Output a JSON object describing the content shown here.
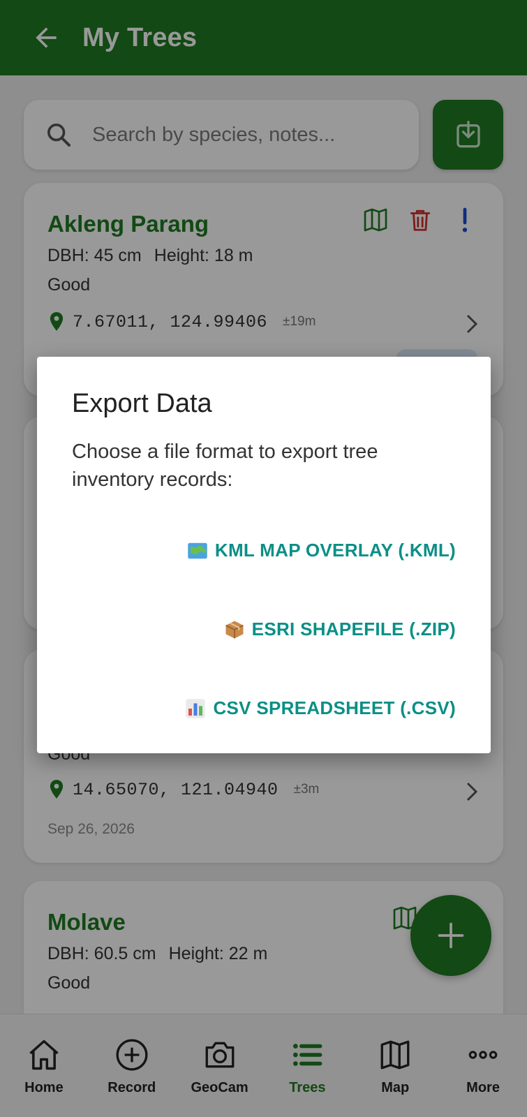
{
  "appbar": {
    "title": "My Trees"
  },
  "search": {
    "placeholder": "Search by species, notes..."
  },
  "cards": [
    {
      "species": "Akleng Parang",
      "dbh": "DBH: 45 cm",
      "height": "Height: 18 m",
      "condition": "Good",
      "coords": "7.67011, 124.99406",
      "accuracy": "±19m"
    },
    {
      "condition": "Good",
      "coords": "14.65070, 121.04940",
      "accuracy": "±3m",
      "date": "Sep 26, 2026"
    },
    {
      "species": "Molave",
      "dbh": "DBH: 60.5 cm",
      "height": "Height: 22 m",
      "condition": "Good"
    }
  ],
  "nav": [
    {
      "label": "Home",
      "icon": "home-icon"
    },
    {
      "label": "Record",
      "icon": "plus-circle-icon"
    },
    {
      "label": "GeoCam",
      "icon": "camera-icon"
    },
    {
      "label": "Trees",
      "icon": "list-icon"
    },
    {
      "label": "Map",
      "icon": "map-icon"
    },
    {
      "label": "More",
      "icon": "more-icon"
    }
  ],
  "dialog": {
    "title": "Export Data",
    "message": "Choose a file format to export tree inventory records:",
    "options": [
      {
        "label": "KML MAP OVERLAY (.KML)",
        "icon": "world-map-icon"
      },
      {
        "label": "ESRI SHAPEFILE (.ZIP)",
        "icon": "package-icon"
      },
      {
        "label": "CSV SPREADSHEET (.CSV)",
        "icon": "bar-chart-icon"
      }
    ]
  },
  "colors": {
    "primary": "#1f7a22",
    "dialog_button": "#0a8f86",
    "delete": "#d32f2f",
    "alert": "#1a4fd1"
  }
}
